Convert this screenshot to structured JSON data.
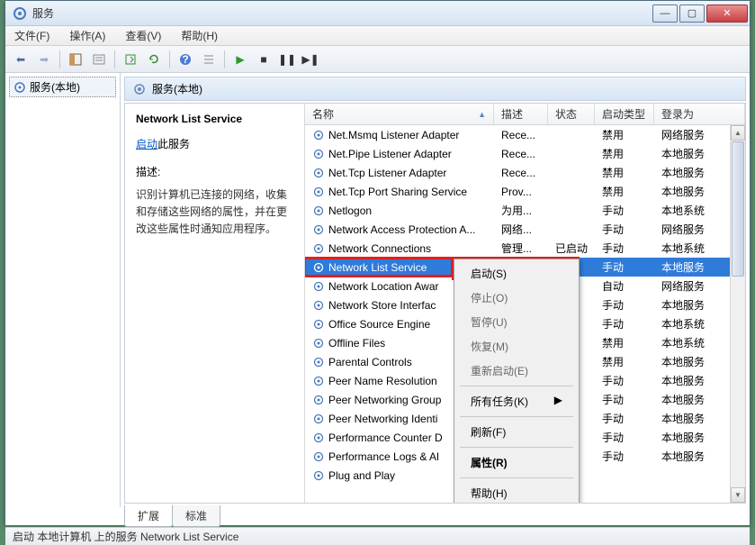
{
  "window": {
    "title": "服务"
  },
  "menubar": [
    "文件(F)",
    "操作(A)",
    "查看(V)",
    "帮助(H)"
  ],
  "tree": {
    "node": "服务(本地)"
  },
  "main_header": "服务(本地)",
  "detail": {
    "title": "Network List Service",
    "action_link": "启动",
    "action_suffix": "此服务",
    "desc_label": "描述:",
    "desc_text": "识别计算机已连接的网络，收集和存储这些网络的属性，并在更改这些属性时通知应用程序。"
  },
  "columns": {
    "name": "名称",
    "desc": "描述",
    "status": "状态",
    "start": "启动类型",
    "logon": "登录为"
  },
  "services": [
    {
      "name": "Net.Msmq Listener Adapter",
      "desc": "Rece...",
      "status": "",
      "start": "禁用",
      "logon": "网络服务"
    },
    {
      "name": "Net.Pipe Listener Adapter",
      "desc": "Rece...",
      "status": "",
      "start": "禁用",
      "logon": "本地服务"
    },
    {
      "name": "Net.Tcp Listener Adapter",
      "desc": "Rece...",
      "status": "",
      "start": "禁用",
      "logon": "本地服务"
    },
    {
      "name": "Net.Tcp Port Sharing Service",
      "desc": "Prov...",
      "status": "",
      "start": "禁用",
      "logon": "本地服务"
    },
    {
      "name": "Netlogon",
      "desc": "为用...",
      "status": "",
      "start": "手动",
      "logon": "本地系统"
    },
    {
      "name": "Network Access Protection A...",
      "desc": "网络...",
      "status": "",
      "start": "手动",
      "logon": "网络服务"
    },
    {
      "name": "Network Connections",
      "desc": "管理...",
      "status": "已启动",
      "start": "手动",
      "logon": "本地系统"
    },
    {
      "name": "Network List Service",
      "desc": "",
      "status": "",
      "start": "手动",
      "logon": "本地服务",
      "selected": true
    },
    {
      "name": "Network Location Awar",
      "desc": "",
      "status": "",
      "start": "自动",
      "logon": "网络服务"
    },
    {
      "name": "Network Store Interfac",
      "desc": "",
      "status": "",
      "start": "手动",
      "logon": "本地服务"
    },
    {
      "name": "Office Source Engine",
      "desc": "",
      "status": "",
      "start": "手动",
      "logon": "本地系统"
    },
    {
      "name": "Offline Files",
      "desc": "",
      "status": "",
      "start": "禁用",
      "logon": "本地系统"
    },
    {
      "name": "Parental Controls",
      "desc": "",
      "status": "",
      "start": "禁用",
      "logon": "本地服务"
    },
    {
      "name": "Peer Name Resolution",
      "desc": "",
      "status": "",
      "start": "手动",
      "logon": "本地服务"
    },
    {
      "name": "Peer Networking Group",
      "desc": "",
      "status": "",
      "start": "手动",
      "logon": "本地服务"
    },
    {
      "name": "Peer Networking Identi",
      "desc": "",
      "status": "",
      "start": "手动",
      "logon": "本地服务"
    },
    {
      "name": "Performance Counter D",
      "desc": "",
      "status": "",
      "start": "手动",
      "logon": "本地服务"
    },
    {
      "name": "Performance Logs & Al",
      "desc": "",
      "status": "",
      "start": "手动",
      "logon": "本地服务"
    },
    {
      "name": "Plug and Play",
      "desc": "",
      "status": "",
      "start": "",
      "logon": ""
    }
  ],
  "context_menu": [
    {
      "label": "启动(S)",
      "enabled": true,
      "highlight": true
    },
    {
      "label": "停止(O)",
      "enabled": false
    },
    {
      "label": "暂停(U)",
      "enabled": false
    },
    {
      "label": "恢复(M)",
      "enabled": false
    },
    {
      "label": "重新启动(E)",
      "enabled": false
    },
    {
      "sep": true
    },
    {
      "label": "所有任务(K)",
      "enabled": true,
      "submenu": true
    },
    {
      "sep": true
    },
    {
      "label": "刷新(F)",
      "enabled": true
    },
    {
      "sep": true
    },
    {
      "label": "属性(R)",
      "enabled": true,
      "bold": true
    },
    {
      "sep": true
    },
    {
      "label": "帮助(H)",
      "enabled": true
    }
  ],
  "tabs": {
    "ext": "扩展",
    "std": "标准"
  },
  "statusbar": "启动 本地计算机 上的服务 Network List Service"
}
